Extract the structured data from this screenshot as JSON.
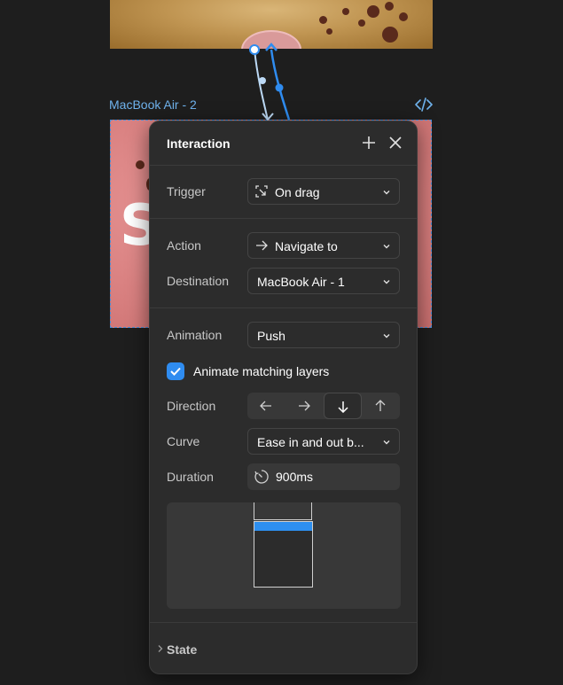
{
  "canvas": {
    "frame_label": "MacBook Air - 2",
    "code_icon": "code-icon"
  },
  "panel": {
    "title": "Interaction",
    "add_icon": "plus-icon",
    "close_icon": "close-icon"
  },
  "trigger": {
    "label": "Trigger",
    "value": "On drag",
    "icon": "drag-icon"
  },
  "action": {
    "label": "Action",
    "value": "Navigate to",
    "icon": "arrow-right-icon"
  },
  "destination": {
    "label": "Destination",
    "value": "MacBook Air - 1"
  },
  "animation": {
    "label": "Animation",
    "value": "Push"
  },
  "animate_matching": {
    "label": "Animate matching layers",
    "checked": true
  },
  "direction": {
    "label": "Direction",
    "options": [
      "left",
      "right",
      "down",
      "up"
    ],
    "selected": "down"
  },
  "curve": {
    "label": "Curve",
    "value": "Ease in and out b..."
  },
  "duration": {
    "label": "Duration",
    "value": "900ms",
    "icon": "timer-icon"
  },
  "state": {
    "label": "State"
  },
  "colors": {
    "accent": "#2f8cf0",
    "panel_bg": "#2c2c2c",
    "canvas_bg": "#1e1e1e",
    "frame_label": "#6fb2ec"
  }
}
